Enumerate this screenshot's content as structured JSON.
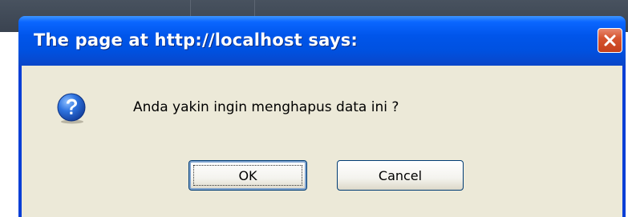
{
  "dialog": {
    "title": "The page at http://localhost says:",
    "message": "Anda yakin ingin menghapus data ini ?",
    "icon": "question-icon",
    "close_icon": "close-icon"
  },
  "buttons": {
    "ok_label": "OK",
    "cancel_label": "Cancel"
  },
  "colors": {
    "titlebar": "#0055ea",
    "body_background": "#ece9d8",
    "close_button": "#d6542f",
    "icon_blue": "#1f5fcf"
  }
}
